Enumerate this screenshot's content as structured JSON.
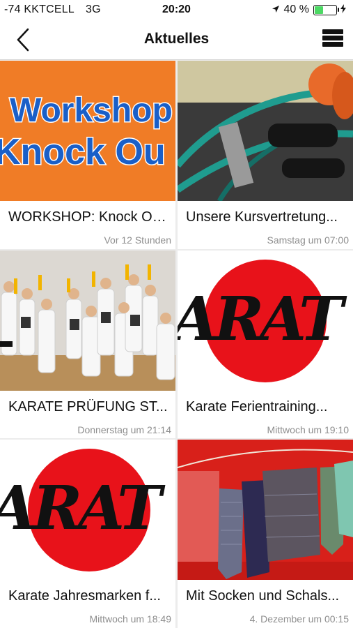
{
  "status_bar": {
    "carrier": "-74 KKTCELL",
    "network": "3G",
    "time": "20:20",
    "battery": "40 %",
    "battery_level": 0.4,
    "location_icon": "location-arrow-icon",
    "charging_icon": "bolt-icon"
  },
  "nav": {
    "title": "Aktuelles",
    "back_icon": "chevron-left-icon",
    "menu_icon": "list-menu-icon"
  },
  "cards": [
    {
      "title": "WORKSHOP: Knock Out...",
      "time": "Vor 12 Stunden",
      "thumb_text": [
        "Workshop",
        "Knock Ou"
      ]
    },
    {
      "title": "Unsere Kursvertretung...",
      "time": "Samstag um 07:00"
    },
    {
      "title": "KARATE PRÜFUNG ST...",
      "time": "Donnerstag um 21:14"
    },
    {
      "title": "Karate Ferientraining...",
      "time": "Mittwoch um 19:10",
      "thumb_text": "ARAT"
    },
    {
      "title": "Karate Jahresmarken f...",
      "time": "Mittwoch um 18:49",
      "thumb_text": "ARAT"
    },
    {
      "title": "Mit Socken und Schals...",
      "time": "4. Dezember um 00:15"
    }
  ],
  "colors": {
    "workshop_bg": "#f07c26",
    "workshop_text": "#1a5fc8",
    "karate_red": "#e8121a",
    "battery_green": "#4cd964"
  }
}
